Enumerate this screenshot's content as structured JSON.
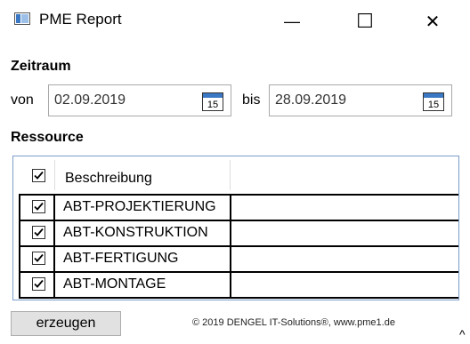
{
  "window": {
    "title": "PME Report",
    "minimize_glyph": "—",
    "maximize_glyph": "☐",
    "close_glyph": "✕"
  },
  "zeitraum": {
    "heading": "Zeitraum",
    "from_label": "von",
    "from_value": "02.09.2019",
    "to_label": "bis",
    "to_value": "28.09.2019",
    "calendar_day": "15"
  },
  "ressource": {
    "heading": "Ressource",
    "column_header": "Beschreibung",
    "header_checked": true,
    "rows": [
      {
        "label": "ABT-PROJEKTIERUNG",
        "checked": true
      },
      {
        "label": "ABT-KONSTRUKTION",
        "checked": true
      },
      {
        "label": "ABT-FERTIGUNG",
        "checked": true
      },
      {
        "label": "ABT-MONTAGE",
        "checked": true
      }
    ]
  },
  "actions": {
    "generate_label": "erzeugen"
  },
  "footer": {
    "copyright": "© 2019 DENGEL IT-Solutions®, www.pme1.de",
    "caret": "^"
  },
  "colors": {
    "grid_border": "#7a9ec8",
    "button_bg": "#e1e1e1",
    "calendar_blue": "#3a78c3"
  }
}
